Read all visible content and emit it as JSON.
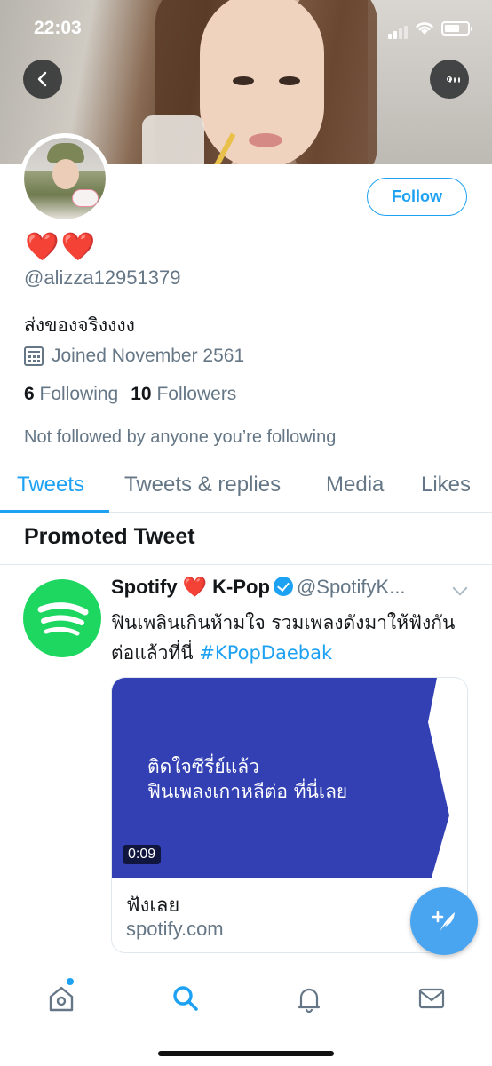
{
  "status_bar": {
    "time": "22:03"
  },
  "profile": {
    "display_name": "❤️❤️",
    "handle": "@alizza12951379",
    "bio": "ส่งของจริงงงง",
    "joined": "Joined November 2561",
    "following_count": "6",
    "following_label": "Following",
    "followers_count": "10",
    "followers_label": "Followers",
    "not_followed_text": "Not followed by anyone you’re following",
    "follow_button": "Follow"
  },
  "tabs": [
    {
      "label": "Tweets",
      "active": true
    },
    {
      "label": "Tweets & replies",
      "active": false
    },
    {
      "label": "Media",
      "active": false
    },
    {
      "label": "Likes",
      "active": false
    }
  ],
  "promoted_heading": "Promoted Tweet",
  "tweet": {
    "name": "Spotify ❤️ K-Pop",
    "handle": "@SpotifyK...",
    "text": "ฟินเพลินเกินห้ามใจ รวมเพลงดังมาให้ฟังกันต่อแล้วที่นี่ ",
    "hashtag": "#KPopDaebak",
    "card": {
      "headline_line1": "ติดใจซีรี่ย์แล้ว",
      "headline_line2": "ฟินเพลงเกาหลีต่อ ที่นี่เลย",
      "duration": "0:09",
      "title": "ฟังเลย",
      "domain": "spotify.com"
    }
  },
  "colors": {
    "accent": "#1da1f2",
    "spotify_green": "#1ed760",
    "card_blue": "#3340b3",
    "text_secondary": "#657786"
  },
  "icons": {
    "back": "chevron-left-icon",
    "more": "more-icon",
    "calendar": "calendar-icon",
    "verified": "verified-badge-icon",
    "compose": "compose-tweet-icon",
    "nav": [
      "home-icon",
      "search-icon",
      "notifications-icon",
      "messages-icon"
    ]
  }
}
